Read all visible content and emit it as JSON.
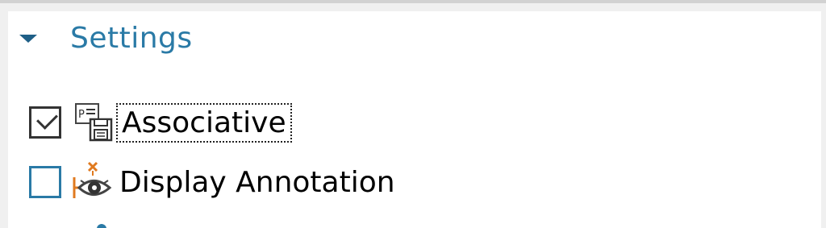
{
  "section": {
    "title": "Settings",
    "expanded": true
  },
  "options": [
    {
      "label": "Associative",
      "checked": true,
      "focused": true,
      "icon": "associative-save-icon"
    },
    {
      "label": "Display Annotation",
      "checked": false,
      "focused": false,
      "icon": "display-annotation-eye-icon"
    }
  ],
  "colors": {
    "accent": "#2a7aa6",
    "caret": "#1f5f87",
    "icon_orange": "#e07a1f"
  }
}
